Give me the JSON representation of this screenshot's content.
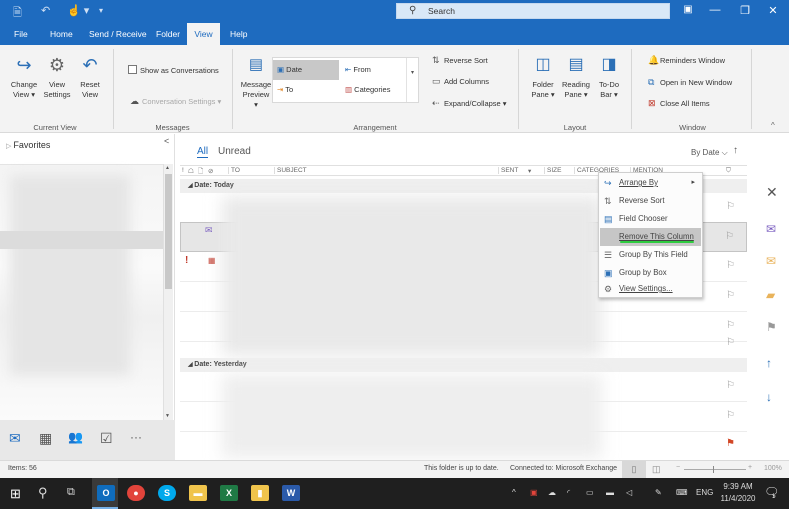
{
  "titlebar": {
    "qat": [
      {
        "icon": "send-receive-all-icon"
      },
      {
        "icon": "undo-icon",
        "glyph": "↶"
      },
      {
        "icon": "touch-mode-icon",
        "glyph": "☝ ▾"
      },
      {
        "icon": "customize-qat-icon",
        "glyph": "▾"
      }
    ],
    "search_placeholder": "Search",
    "search_icon": "⚲",
    "window_controls": {
      "ribbon_display": "▣",
      "minimize": "—",
      "restore": "❐",
      "close": "✕"
    }
  },
  "tabs": [
    {
      "label": "File",
      "active": false
    },
    {
      "label": "Home",
      "active": false
    },
    {
      "label": "Send / Receive",
      "active": false
    },
    {
      "label": "Folder",
      "active": false
    },
    {
      "label": "View",
      "active": true
    },
    {
      "label": "Help",
      "active": false
    }
  ],
  "ribbon": {
    "current_view": {
      "label": "Current View",
      "change_view": "Change View ▾",
      "view_settings": "View Settings",
      "reset_view": "Reset View"
    },
    "messages": {
      "label": "Messages",
      "show_as_conversations": "Show as Conversations",
      "show_as_conversations_checked": false,
      "conversation_settings": "Conversation Settings ▾"
    },
    "arrangement": {
      "label": "Arrangement",
      "message_preview": "Message Preview ▾",
      "gallery": [
        {
          "label": "Date",
          "selected": true
        },
        {
          "label": "From",
          "selected": false
        },
        {
          "label": "To",
          "selected": false
        },
        {
          "label": "Categories",
          "selected": false
        }
      ],
      "reverse_sort": "Reverse Sort",
      "add_columns": "Add Columns",
      "expand_collapse": "Expand/Collapse ▾"
    },
    "layout": {
      "label": "Layout",
      "folder_pane": "Folder Pane ▾",
      "reading_pane": "Reading Pane ▾",
      "todo_bar": "To-Do Bar ▾"
    },
    "window": {
      "label": "Window",
      "reminders_window": "Reminders Window",
      "open_in_new_window": "Open in New Window",
      "close_all_items": "Close All Items"
    },
    "collapse_glyph": "^"
  },
  "folder_pane": {
    "favorites": "Favorites",
    "collapse_glyph": "<"
  },
  "nav": [
    {
      "icon": "mail-icon",
      "glyph": "✉",
      "active": true
    },
    {
      "icon": "calendar-icon",
      "glyph": "▦",
      "active": false
    },
    {
      "icon": "people-icon",
      "glyph": "👥",
      "active": false
    },
    {
      "icon": "tasks-icon",
      "glyph": "☑",
      "active": false
    },
    {
      "icon": "more-icon",
      "glyph": "···",
      "active": false
    }
  ],
  "message_list": {
    "filters": [
      {
        "label": "All",
        "active": true
      },
      {
        "label": "Unread",
        "active": false
      }
    ],
    "sort_label": "By Date ⌵",
    "sort_dir_glyph": "↑",
    "columns": [
      "!",
      "☖",
      "🗋",
      "⊘",
      "TO",
      "SUBJECT",
      "SENT",
      "▾",
      "SIZE",
      "CATEGORIES",
      "MENTION",
      "⛉"
    ],
    "groups": [
      {
        "label": "Date: Today"
      },
      {
        "label": "Date: Yesterday"
      }
    ],
    "flag_glyph": "⚐",
    "flag_red_glyph": "⚑",
    "importance_glyph": "!"
  },
  "context_menu": {
    "items": [
      {
        "label": "Arrange By",
        "icon": "arrange-by-icon",
        "glyph": "↪",
        "submenu": true,
        "highlight": false
      },
      {
        "label": "Reverse Sort",
        "icon": "reverse-sort-icon",
        "glyph": "⇅",
        "submenu": false,
        "highlight": false
      },
      {
        "label": "Field Chooser",
        "icon": "field-chooser-icon",
        "glyph": "▤",
        "submenu": false,
        "highlight": false
      },
      {
        "label": "Remove This Column",
        "icon": "",
        "glyph": "",
        "submenu": false,
        "highlight": true
      },
      {
        "label": "Group By This Field",
        "icon": "group-by-field-icon",
        "glyph": "☰",
        "submenu": false,
        "highlight": false
      },
      {
        "label": "Group by Box",
        "icon": "group-by-box-icon",
        "glyph": "▣",
        "submenu": false,
        "highlight": false
      },
      {
        "label": "View Settings...",
        "icon": "view-settings-icon",
        "glyph": "⚙",
        "submenu": false,
        "highlight": false
      }
    ],
    "submenu_glyph": "▸"
  },
  "right_rail": [
    {
      "icon": "delete-icon",
      "glyph": "✕",
      "color": "#555555"
    },
    {
      "icon": "reply-icon",
      "glyph": "✉",
      "color": "#7b5fc0"
    },
    {
      "icon": "unread-mail-icon",
      "glyph": "✉",
      "color": "#e9b35b"
    },
    {
      "icon": "move-to-folder-icon",
      "glyph": "▰",
      "color": "#e9b35b"
    },
    {
      "icon": "flag-icon",
      "glyph": "⚑",
      "color": "#999999"
    },
    {
      "icon": "previous-item-icon",
      "glyph": "↑",
      "color": "#2b6fb6"
    },
    {
      "icon": "next-item-icon",
      "glyph": "↓",
      "color": "#2b6fb6"
    }
  ],
  "status": {
    "items": "Items: 56",
    "folder_status": "This folder is up to date.",
    "connection": "Connected to: Microsoft Exchange",
    "zoom": "100%"
  },
  "taskbar": {
    "apps": [
      {
        "name": "outlook",
        "label": "O",
        "color": "#0f6cbd",
        "active": true
      },
      {
        "name": "chrome",
        "label": "●",
        "color": "#e2443b",
        "active": false
      },
      {
        "name": "skype",
        "label": "S",
        "color": "#00a9ec",
        "active": false
      },
      {
        "name": "file-explorer",
        "label": "▬",
        "color": "#f0c44c",
        "active": false
      },
      {
        "name": "excel",
        "label": "X",
        "color": "#1f7a45",
        "active": false
      },
      {
        "name": "onedrive-files",
        "label": "▮",
        "color": "#f0c44c",
        "active": false
      },
      {
        "name": "word",
        "label": "W",
        "color": "#2b5aa9",
        "active": false
      }
    ],
    "time": "9:39 AM",
    "date": "11/4/2020",
    "lang": "ENG",
    "notification_count": "1"
  },
  "colors": {
    "accent": "#1e6bbf",
    "highlight_underline": "#2ecc40",
    "flag_red": "#d24726"
  }
}
